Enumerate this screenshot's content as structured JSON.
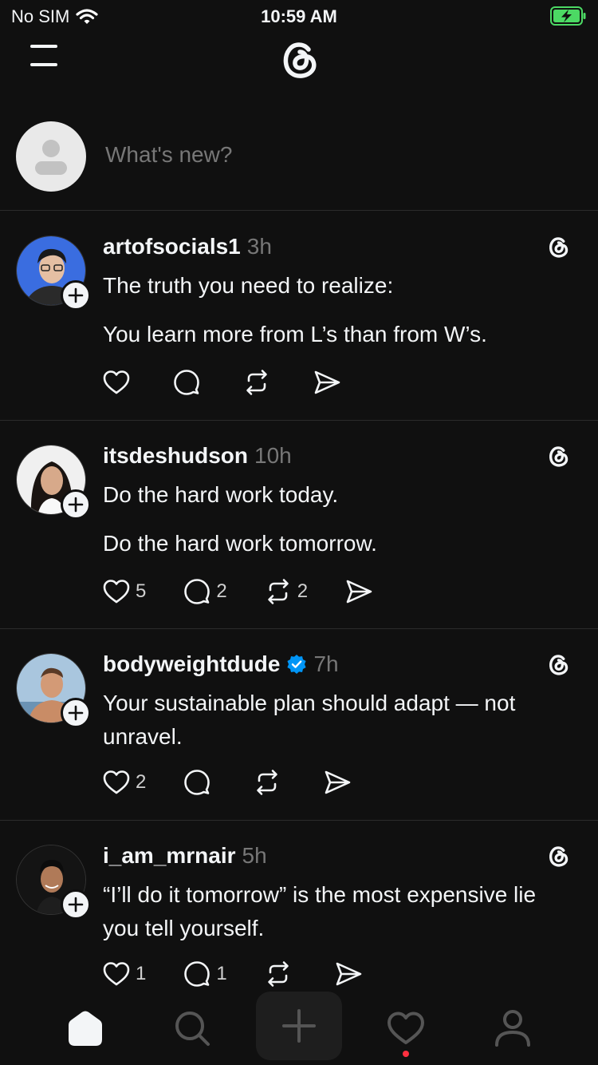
{
  "status_bar": {
    "carrier": "No SIM",
    "time": "10:59 AM",
    "icons": [
      "wifi-icon",
      "battery-charging-icon"
    ],
    "battery_color": "#4cd964"
  },
  "header": {
    "menu_icon": "menu-icon",
    "logo_icon": "threads-logo-icon"
  },
  "composer": {
    "placeholder": "What's new?"
  },
  "posts": [
    {
      "username": "artofsocials1",
      "time": "3h",
      "verified": false,
      "paragraphs": [
        "The truth you need to realize:",
        "You learn more from L’s than from W’s."
      ],
      "counts": {
        "likes": "",
        "replies": "",
        "reposts": ""
      }
    },
    {
      "username": "itsdeshudson",
      "time": "10h",
      "verified": false,
      "paragraphs": [
        "Do the hard work today.",
        "Do the hard work tomorrow."
      ],
      "counts": {
        "likes": "5",
        "replies": "2",
        "reposts": "2"
      }
    },
    {
      "username": "bodyweightdude",
      "time": "7h",
      "verified": true,
      "paragraphs": [
        "Your sustainable plan should adapt — not unravel."
      ],
      "counts": {
        "likes": "2",
        "replies": "",
        "reposts": ""
      }
    },
    {
      "username": "i_am_mrnair",
      "time": "5h",
      "verified": false,
      "paragraphs": [
        "“I’ll do it tomorrow” is the most expensive lie you tell yourself."
      ],
      "counts": {
        "likes": "1",
        "replies": "1",
        "reposts": ""
      }
    }
  ],
  "tab_bar": {
    "tabs": [
      "home-icon",
      "search-icon",
      "create-icon",
      "activity-icon",
      "profile-icon"
    ],
    "notification_dot_color": "#ff3040"
  },
  "colors": {
    "background": "#101010",
    "text": "#f3f5f7",
    "muted": "#777777",
    "verified": "#0095f6"
  }
}
